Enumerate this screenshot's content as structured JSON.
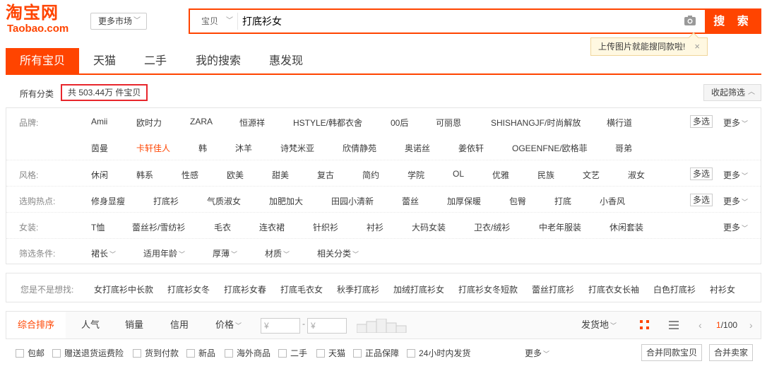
{
  "logo": {
    "cn": "淘宝网",
    "en": "Taobao.com",
    "color": "#ff4400"
  },
  "header": {
    "market_label": "更多市场",
    "search_type": "宝贝",
    "search_value": "打底衫女",
    "search_button": "搜 索",
    "tooltip_text": "上传图片就能搜同款啦!",
    "tooltip_close": "×"
  },
  "tabs": [
    "所有宝贝",
    "天猫",
    "二手",
    "我的搜索",
    "惠发现"
  ],
  "category": {
    "all_label": "所有分类",
    "count_text": "共 503.44万 件宝贝",
    "collapse_label": "收起筛选"
  },
  "filters": {
    "brand": {
      "label": "品牌:",
      "row1": [
        "Amii",
        "欧时力",
        "ZARA",
        "恒源祥",
        "HSTYLE/韩都衣舍",
        "00后",
        "可丽恩",
        "SHISHANGJF/时尚解放",
        "横行道"
      ],
      "row2": [
        "茵曼",
        "卡轩佳人",
        "韩",
        "沐羊",
        "诗梵米亚",
        "欣倩静苑",
        "奥诺丝",
        "姜依轩",
        "OGEENFNE/欧格菲",
        "哥弟"
      ]
    },
    "style": {
      "label": "风格:",
      "items": [
        "休闲",
        "韩系",
        "性感",
        "欧美",
        "甜美",
        "复古",
        "简约",
        "学院",
        "OL",
        "优雅",
        "民族",
        "文艺",
        "淑女"
      ]
    },
    "hot": {
      "label": "选购热点:",
      "items": [
        "修身显瘦",
        "打底衫",
        "气质淑女",
        "加肥加大",
        "田园小清新",
        "蕾丝",
        "加厚保暖",
        "包臀",
        "打底",
        "小香风"
      ]
    },
    "women": {
      "label": "女装:",
      "items": [
        "T恤",
        "蕾丝衫/雪纺衫",
        "毛衣",
        "连衣裙",
        "针织衫",
        "衬衫",
        "大码女装",
        "卫衣/绒衫",
        "中老年服装",
        "休闲套装"
      ]
    },
    "conditions": {
      "label": "筛选条件:",
      "items": [
        "裙长",
        "适用年龄",
        "厚薄",
        "材质",
        "相关分类"
      ]
    },
    "multi_label": "多选",
    "more_label": "更多"
  },
  "suggest": {
    "label": "您是不是想找:",
    "items": [
      "女打底衫中长款",
      "打底衫女冬",
      "打底衫女春",
      "打底毛衣女",
      "秋季打底衫",
      "加绒打底衫女",
      "打底衫女冬短款",
      "蕾丝打底衫",
      "打底衣女长袖",
      "白色打底衫",
      "衬衫女"
    ]
  },
  "sort": {
    "items": [
      "综合排序",
      "人气",
      "销量",
      "信用",
      "价格"
    ],
    "price_from": "¥",
    "price_to": "¥",
    "price_dash": "-",
    "ship_label": "发货地",
    "page_current": "1",
    "page_total": "/100"
  },
  "options": {
    "items": [
      "包邮",
      "赠送退货运费险",
      "货到付款",
      "新品",
      "海外商品",
      "二手",
      "天猫",
      "正品保障",
      "24小时内发货"
    ],
    "more_label": "更多",
    "merge_same": "合并同款宝贝",
    "merge_seller": "合并卖家"
  },
  "icons": {
    "camera": "camera-icon",
    "grid": "grid-view-icon",
    "list": "list-view-icon",
    "chevron": "chevron-down-icon"
  }
}
